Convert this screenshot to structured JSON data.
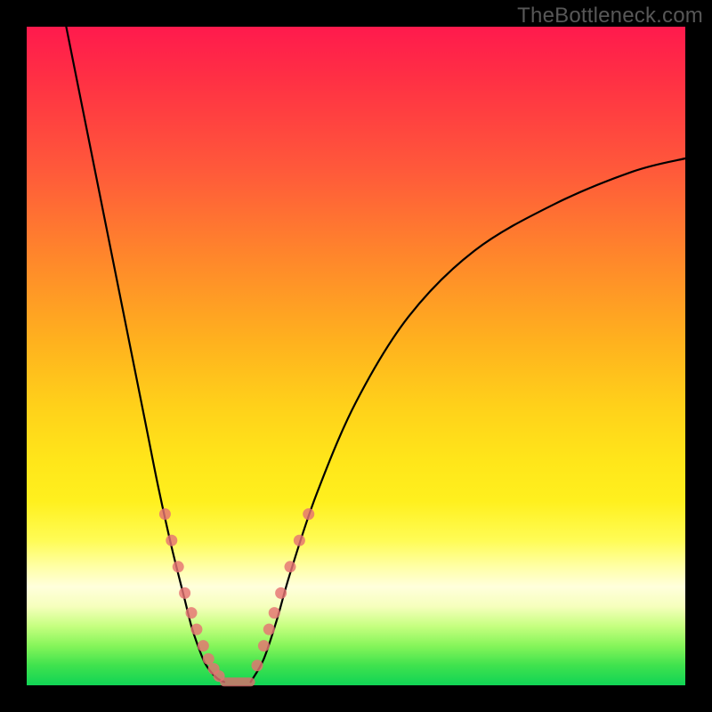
{
  "watermark": "TheBottleneck.com",
  "colors": {
    "frame": "#000000",
    "curve": "#000000",
    "dots": "#e57373"
  },
  "chart_data": {
    "type": "line",
    "title": "",
    "xlabel": "",
    "ylabel": "",
    "xlim": [
      0,
      100
    ],
    "ylim": [
      0,
      100
    ],
    "grid": false,
    "legend": false,
    "series": [
      {
        "name": "left-curve",
        "x": [
          6,
          10,
          14,
          18,
          20,
          22,
          24,
          25,
          26,
          27,
          28,
          29,
          30
        ],
        "y": [
          100,
          80,
          60,
          40,
          30,
          21,
          13,
          9,
          6,
          3.5,
          2,
          1,
          0.5
        ]
      },
      {
        "name": "right-curve",
        "x": [
          34,
          36,
          38,
          40,
          44,
          50,
          58,
          68,
          80,
          92,
          100
        ],
        "y": [
          0.5,
          4,
          10,
          17,
          29,
          43,
          56,
          66,
          73,
          78,
          80
        ]
      }
    ],
    "annotations": {
      "scatter_overlay": {
        "name": "marker-dots",
        "color": "#e57373",
        "points": [
          {
            "x": 21.0,
            "y": 26
          },
          {
            "x": 22.0,
            "y": 22
          },
          {
            "x": 23.0,
            "y": 18
          },
          {
            "x": 24.0,
            "y": 14
          },
          {
            "x": 25.0,
            "y": 11
          },
          {
            "x": 25.8,
            "y": 8.5
          },
          {
            "x": 26.8,
            "y": 6
          },
          {
            "x": 27.6,
            "y": 4
          },
          {
            "x": 28.4,
            "y": 2.5
          },
          {
            "x": 29.2,
            "y": 1.4
          },
          {
            "x": 35.0,
            "y": 3
          },
          {
            "x": 36.0,
            "y": 6
          },
          {
            "x": 36.8,
            "y": 8.5
          },
          {
            "x": 37.6,
            "y": 11
          },
          {
            "x": 38.6,
            "y": 14
          },
          {
            "x": 40.0,
            "y": 18
          },
          {
            "x": 41.4,
            "y": 22
          },
          {
            "x": 42.8,
            "y": 26
          }
        ]
      },
      "flat_bottom": {
        "x_from": 30,
        "x_to": 34,
        "y": 0.5
      }
    },
    "background_gradient": {
      "direction": "vertical",
      "stops": [
        {
          "pos": 0,
          "color": "#ff1a4d"
        },
        {
          "pos": 50,
          "color": "#ffd21a"
        },
        {
          "pos": 85,
          "color": "#ffffdc"
        },
        {
          "pos": 100,
          "color": "#11d455"
        }
      ]
    }
  }
}
